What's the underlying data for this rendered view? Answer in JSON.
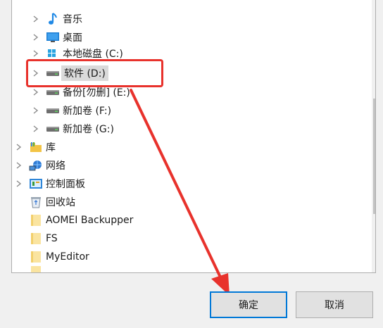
{
  "tree": {
    "items": [
      {
        "label": "音乐",
        "icon": "music-note-icon"
      },
      {
        "label": "桌面",
        "icon": "desktop-icon"
      },
      {
        "label": "本地磁盘 (C:)",
        "icon": "windows-drive-icon"
      },
      {
        "label": "软件 (D:)",
        "icon": "drive-icon",
        "selected": true
      },
      {
        "label": "备份[勿删] (E:)",
        "icon": "drive-icon"
      },
      {
        "label": "新加卷 (F:)",
        "icon": "drive-icon"
      },
      {
        "label": "新加卷 (G:)",
        "icon": "drive-icon"
      },
      {
        "label": "库",
        "icon": "library-icon"
      },
      {
        "label": "网络",
        "icon": "network-icon"
      },
      {
        "label": "控制面板",
        "icon": "control-panel-icon"
      },
      {
        "label": "回收站",
        "icon": "recycle-bin-icon"
      },
      {
        "label": "AOMEI Backupper",
        "icon": "folder-icon"
      },
      {
        "label": "FS",
        "icon": "folder-icon"
      },
      {
        "label": "MyEditor",
        "icon": "folder-icon"
      }
    ]
  },
  "buttons": {
    "ok_label": "确定",
    "cancel_label": "取消"
  },
  "colors": {
    "highlight": "#e8322c",
    "focus_border": "#0078d7",
    "folder": "#f8d775"
  }
}
